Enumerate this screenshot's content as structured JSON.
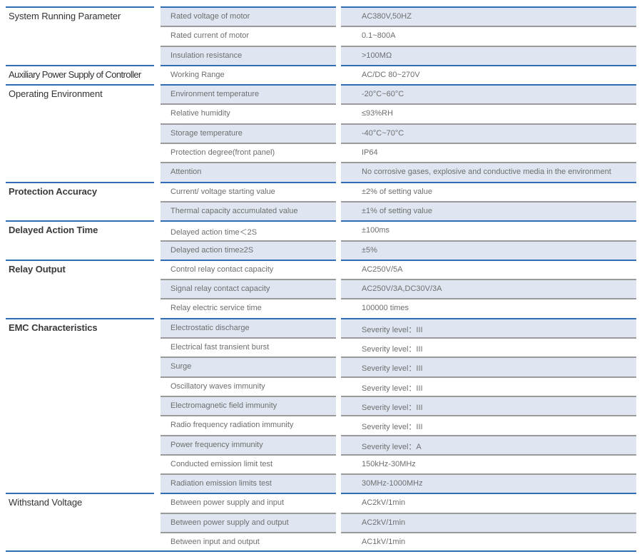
{
  "sections": [
    {
      "title": "System Running Parameter",
      "rows": [
        {
          "name": "Rated voltage of motor",
          "value": "AC380V,50HZ"
        },
        {
          "name": "Rated current of motor",
          "value": "0.1~800A"
        },
        {
          "name": "Insulation resistance",
          "value": ">100MΩ"
        }
      ]
    },
    {
      "title": "Auxiliary Power Supply of Controller",
      "rows": [
        {
          "name": "Working Range",
          "value": "AC/DC 80~270V"
        }
      ]
    },
    {
      "title": "Operating Environment",
      "rows": [
        {
          "name": "Environment temperature",
          "value": "-20°C~60°C"
        },
        {
          "name": "Relative humidity",
          "value": "≤93%RH"
        },
        {
          "name": "Storage temperature",
          "value": "-40°C~70°C"
        },
        {
          "name": "Protection degree(front panel)",
          "value": "IP64"
        },
        {
          "name": "Attention",
          "value": "No corrosive gases, explosive and conductive media in the environment"
        }
      ]
    },
    {
      "title": "Protection Accuracy",
      "rows": [
        {
          "name": "Current/ voltage starting value",
          "value": "±2% of setting value"
        },
        {
          "name": "Thermal capacity accumulated value",
          "value": "±1% of setting value"
        }
      ]
    },
    {
      "title": "Delayed Action Time",
      "rows": [
        {
          "name": "Delayed action time＜2S",
          "value": "±100ms"
        },
        {
          "name": "Delayed action time≥2S",
          "value": "±5%"
        }
      ]
    },
    {
      "title": "Relay Output",
      "rows": [
        {
          "name": "Control relay contact capacity",
          "value": "AC250V/5A"
        },
        {
          "name": "Signal relay contact capacity",
          "value": "AC250V/3A,DC30V/3A"
        },
        {
          "name": "Relay electric service time",
          "value": "100000 times"
        }
      ]
    },
    {
      "title": "EMC Characteristics",
      "rows": [
        {
          "name": "Electrostatic discharge",
          "value": "Severity level：III"
        },
        {
          "name": "Electrical fast transient burst",
          "value": "Severity level：III"
        },
        {
          "name": "Surge",
          "value": "Severity level：III"
        },
        {
          "name": "Oscillatory waves immunity",
          "value": "Severity level：III"
        },
        {
          "name": "Electromagnetic field immunity",
          "value": "Severity level：III"
        },
        {
          "name": "Radio frequency radiation immunity",
          "value": "Severity level：III"
        },
        {
          "name": "Power frequency immunity",
          "value": "Severity level：A"
        },
        {
          "name": "Conducted emission limit test",
          "value": "150kHz-30MHz"
        },
        {
          "name": "Radiation emission limits test",
          "value": "30MHz-1000MHz"
        }
      ]
    },
    {
      "title": "Withstand Voltage",
      "rows": [
        {
          "name": "Between power supply and input",
          "value": "AC2kV/1min"
        },
        {
          "name": "Between power supply and output",
          "value": "AC2kV/1min"
        },
        {
          "name": "Between input and output",
          "value": "AC1kV/1min"
        }
      ]
    }
  ]
}
